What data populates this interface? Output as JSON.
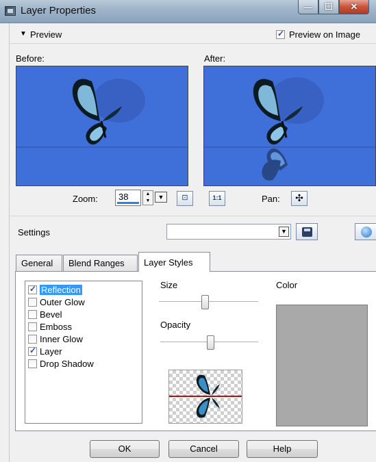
{
  "window": {
    "title": "Layer Properties"
  },
  "preview": {
    "section_label": "Preview",
    "preview_on_image_label": "Preview on Image",
    "preview_on_image_checked": true,
    "before_label": "Before:",
    "after_label": "After:",
    "image_background_color": "#3f6fd8"
  },
  "zoom": {
    "label": "Zoom:",
    "value": "38",
    "fit_button_icon": "fit-window-icon",
    "actual_size_button_label": "1:1"
  },
  "pan": {
    "label": "Pan:",
    "icon": "move-cross-icon"
  },
  "settings": {
    "label": "Settings",
    "preset_value": ""
  },
  "tabs": [
    {
      "label": "General",
      "active": false
    },
    {
      "label": "Blend Ranges",
      "active": false
    },
    {
      "label": "Layer Styles",
      "active": true
    }
  ],
  "layer_styles": {
    "items": [
      {
        "label": "Reflection",
        "checked": true,
        "selected": true
      },
      {
        "label": "Outer Glow",
        "checked": false,
        "selected": false
      },
      {
        "label": "Bevel",
        "checked": false,
        "selected": false
      },
      {
        "label": "Emboss",
        "checked": false,
        "selected": false
      },
      {
        "label": "Inner Glow",
        "checked": false,
        "selected": false
      },
      {
        "label": "Layer",
        "checked": true,
        "selected": false
      },
      {
        "label": "Drop Shadow",
        "checked": false,
        "selected": false
      }
    ],
    "size_label": "Size",
    "size_value_fraction": 0.47,
    "opacity_label": "Opacity",
    "opacity_value_fraction": 0.52,
    "color_label": "Color",
    "color_value": "#a9a9a9"
  },
  "footer": {
    "ok_label": "OK",
    "cancel_label": "Cancel",
    "help_label": "Help"
  }
}
